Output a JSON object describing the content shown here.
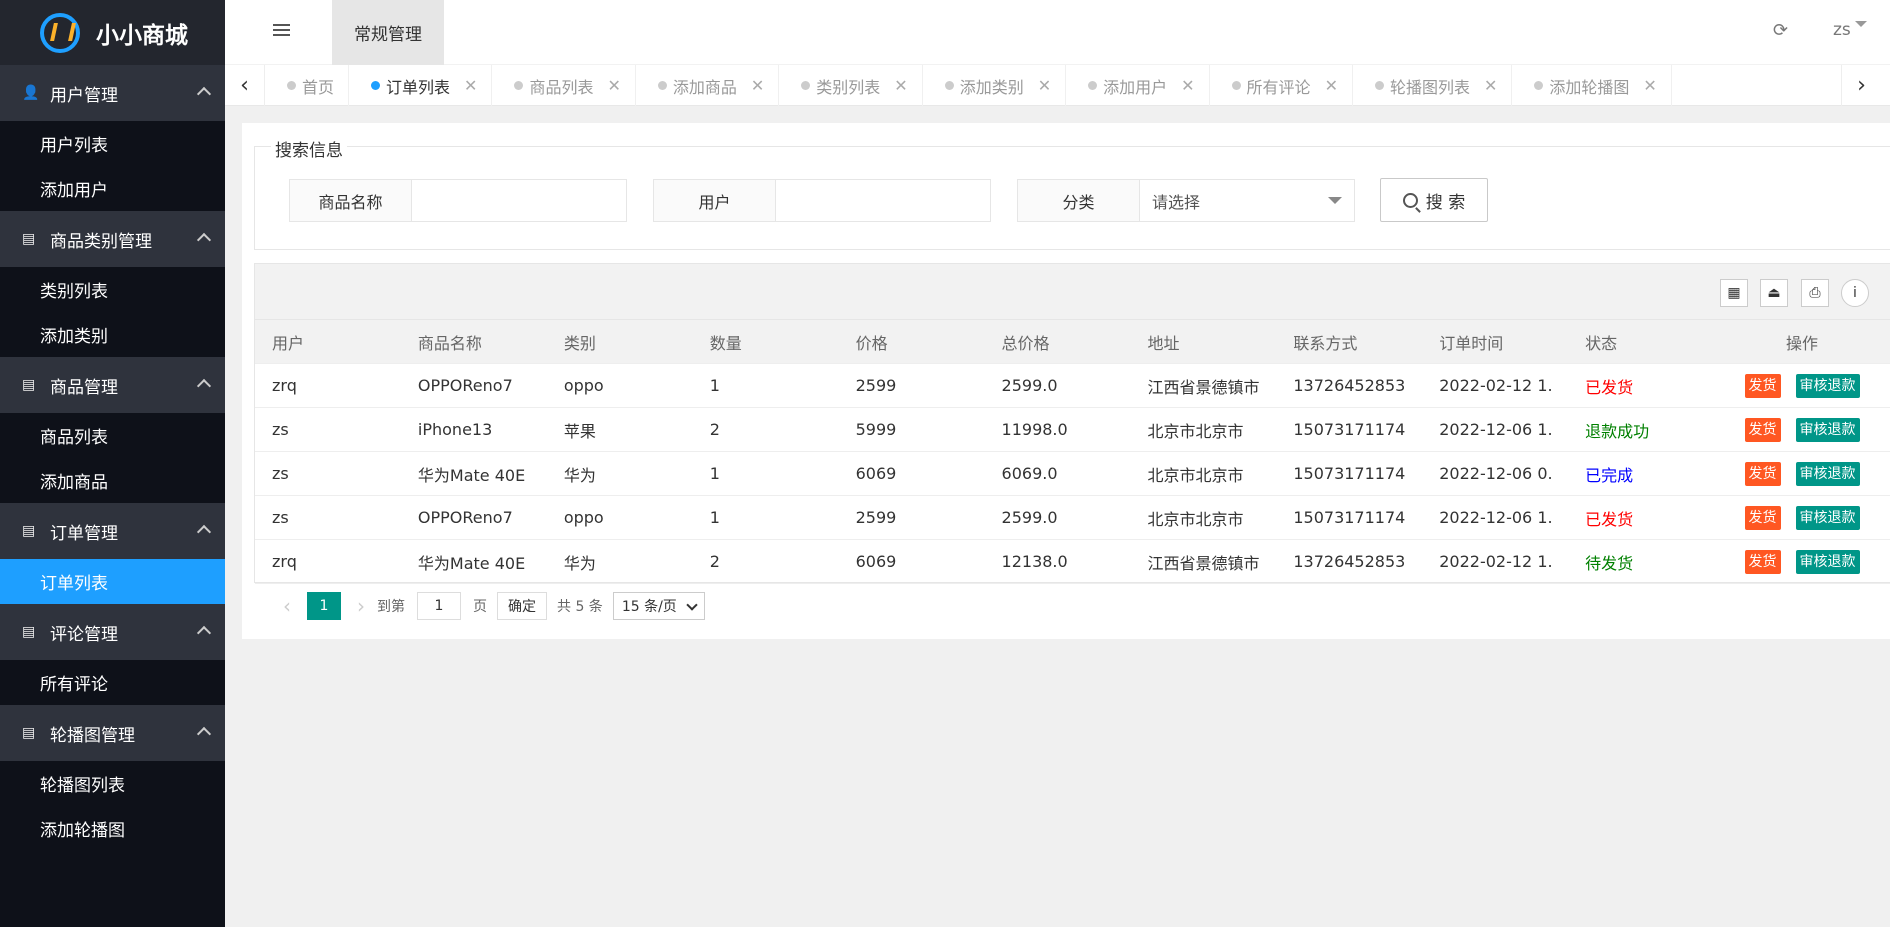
{
  "app": {
    "name": "小小商城"
  },
  "header": {
    "top_tab": "常规管理",
    "user": "zs"
  },
  "sidebar": {
    "groups": [
      {
        "label": "用户管理",
        "icon": "user-icon",
        "items": [
          "用户列表",
          "添加用户"
        ]
      },
      {
        "label": "商品类别管理",
        "icon": "book-icon",
        "items": [
          "类别列表",
          "添加类别"
        ]
      },
      {
        "label": "商品管理",
        "icon": "book-icon",
        "items": [
          "商品列表",
          "添加商品"
        ]
      },
      {
        "label": "订单管理",
        "icon": "book-icon",
        "items": [
          "订单列表"
        ]
      },
      {
        "label": "评论管理",
        "icon": "book-icon",
        "items": [
          "所有评论"
        ]
      },
      {
        "label": "轮播图管理",
        "icon": "book-icon",
        "items": [
          "轮播图列表",
          "添加轮播图"
        ]
      }
    ],
    "active_item": "订单列表"
  },
  "tabs": [
    "首页",
    "订单列表",
    "商品列表",
    "添加商品",
    "类别列表",
    "添加类别",
    "添加用户",
    "所有评论",
    "轮播图列表",
    "添加轮播图"
  ],
  "active_tab": "订单列表",
  "search": {
    "legend": "搜索信息",
    "product_label": "商品名称",
    "user_label": "用户",
    "category_label": "分类",
    "category_placeholder": "请选择",
    "button": "搜 索"
  },
  "table": {
    "columns": [
      "用户",
      "商品名称",
      "类别",
      "数量",
      "价格",
      "总价格",
      "地址",
      "联系方式",
      "订单时间",
      "状态",
      "操作"
    ],
    "rows": [
      {
        "user": "zrq",
        "product": "OPPOReno7",
        "category": "oppo",
        "qty": "1",
        "price": "2599",
        "total": "2599.0",
        "address": "江西省景德镇市",
        "phone": "13726452853",
        "time": "2022-02-12 1...",
        "status": "已发货",
        "status_color": "#ff0000"
      },
      {
        "user": "zs",
        "product": "iPhone13",
        "category": "苹果",
        "qty": "2",
        "price": "5999",
        "total": "11998.0",
        "address": "北京市北京市",
        "phone": "15073171174",
        "time": "2022-12-06 1...",
        "status": "退款成功",
        "status_color": "#008000"
      },
      {
        "user": "zs",
        "product": "华为Mate 40E",
        "category": "华为",
        "qty": "1",
        "price": "6069",
        "total": "6069.0",
        "address": "北京市北京市",
        "phone": "15073171174",
        "time": "2022-12-06 0...",
        "status": "已完成",
        "status_color": "#0000ff"
      },
      {
        "user": "zs",
        "product": "OPPOReno7",
        "category": "oppo",
        "qty": "1",
        "price": "2599",
        "total": "2599.0",
        "address": "北京市北京市",
        "phone": "15073171174",
        "time": "2022-12-06 1...",
        "status": "已发货",
        "status_color": "#ff0000"
      },
      {
        "user": "zrq",
        "product": "华为Mate 40E",
        "category": "华为",
        "qty": "2",
        "price": "6069",
        "total": "12138.0",
        "address": "江西省景德镇市",
        "phone": "13726452853",
        "time": "2022-02-12 1...",
        "status": "待发货",
        "status_color": "#008000"
      }
    ],
    "ship_label": "发货",
    "refund_label": "审核退款"
  },
  "pager": {
    "current": "1",
    "goto_label": "到第",
    "goto_value": "1",
    "page_label": "页",
    "confirm": "确定",
    "total": "共 5 条",
    "page_size": "15 条/页"
  },
  "colors": {
    "primary": "#1e9fff",
    "green": "#009688",
    "orange": "#ff5722",
    "sidebar": "#0e1119"
  }
}
